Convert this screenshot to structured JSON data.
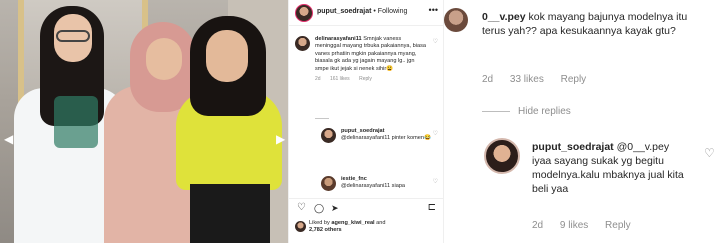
{
  "post": {
    "username": "puput_soedrajat",
    "follow_label": "• Following",
    "more_label": "•••",
    "prev_arrow": "◀",
    "next_arrow": "▶"
  },
  "comments": [
    {
      "username": "delinarasyafani11",
      "text": "Smnjak vaness meninggal mayang trbuka pakaiannya, biasa vanes prhatiin mgkin pakaiannya myang, biasala gk ada yg jagain mayang lg.. jgn smpe ikut jejak si nenek sihir😩",
      "age": "2d",
      "likes": "161 likes",
      "reply": "Reply"
    },
    {
      "username": "puput_soedrajat",
      "text": "@delinarasyafani11 pinter komen😂",
      "age": "",
      "likes": "",
      "reply": ""
    },
    {
      "username": "iestie_fnc",
      "text": "@delinarasyafani11 siapa",
      "age": "",
      "likes": "",
      "reply": ""
    }
  ],
  "actions": {
    "like_icon": "♡",
    "comment_icon": "◯",
    "share_icon": "➤",
    "save_icon": "⊏"
  },
  "liked_by": {
    "prefix": "Liked by ",
    "user": "ageng_kiwi_real",
    "suffix": " and",
    "others": "2,782 others"
  },
  "zoom": {
    "comment1": {
      "username": "0__v.pey",
      "text": "kok mayang bajunya modelnya itu terus yah?? apa kesukaannya kayak gtu?",
      "age": "2d",
      "likes": "33 likes",
      "reply": "Reply"
    },
    "hide_replies": "Hide replies",
    "comment2": {
      "username": "puput_soedrajat",
      "mention": "@0__v.pey",
      "text": "iyaa sayang sukak yg begitu modelnya.kalu mbaknya jual kita beli yaa",
      "age": "2d",
      "likes": "9 likes",
      "reply": "Reply"
    },
    "heart_icon": "♡"
  }
}
